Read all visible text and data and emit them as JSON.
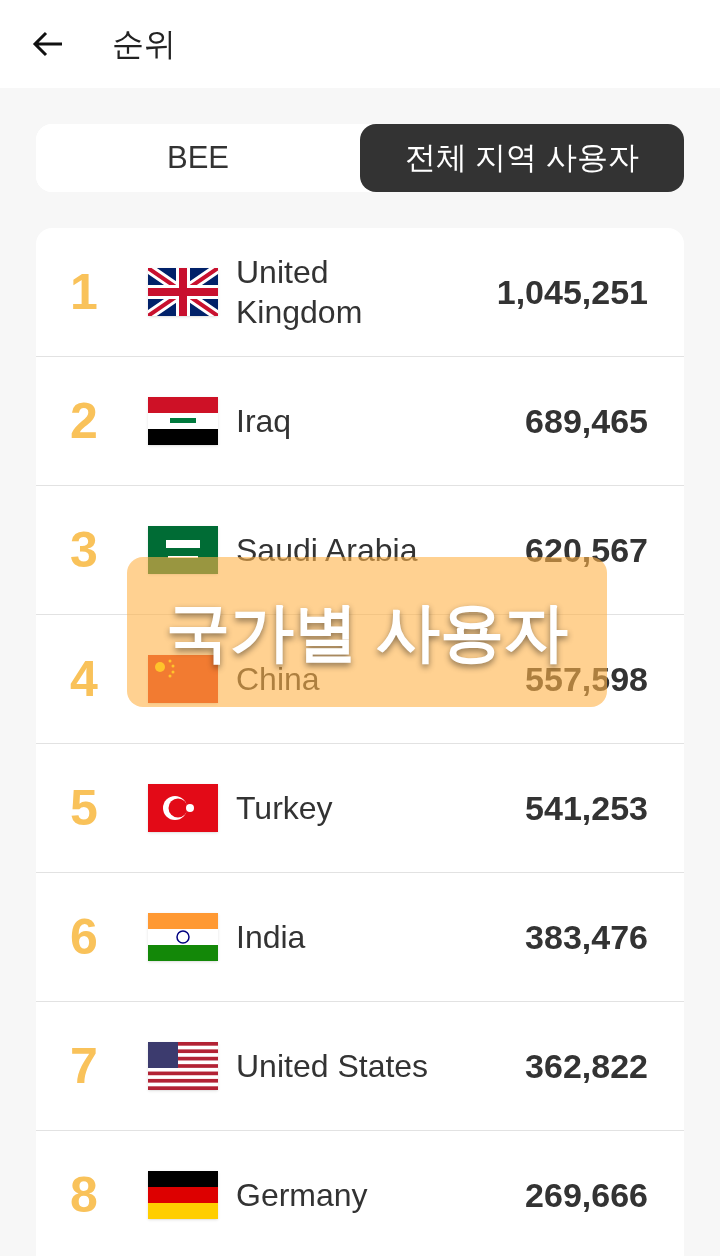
{
  "header": {
    "title": "순위"
  },
  "tabs": [
    {
      "label": "BEE",
      "selected": false
    },
    {
      "label": "전체 지역 사용자",
      "selected": true
    }
  ],
  "rows": [
    {
      "rank": "1",
      "kind": "uk",
      "country": "United Kingdom",
      "users": "1,045,251"
    },
    {
      "rank": "2",
      "kind": "iraq",
      "country": "Iraq",
      "users": "689,465"
    },
    {
      "rank": "3",
      "kind": "saudi",
      "country": "Saudi Arabia",
      "users": "620,567"
    },
    {
      "rank": "4",
      "kind": "china",
      "country": "China",
      "users": "557,598"
    },
    {
      "rank": "5",
      "kind": "turkey",
      "country": "Turkey",
      "users": "541,253"
    },
    {
      "rank": "6",
      "kind": "india",
      "country": "India",
      "users": "383,476"
    },
    {
      "rank": "7",
      "kind": "us",
      "country": "United States",
      "users": "362,822"
    },
    {
      "rank": "8",
      "kind": "germany",
      "country": "Germany",
      "users": "269,666"
    }
  ],
  "overlay": {
    "caption": "국가별 사용자"
  }
}
